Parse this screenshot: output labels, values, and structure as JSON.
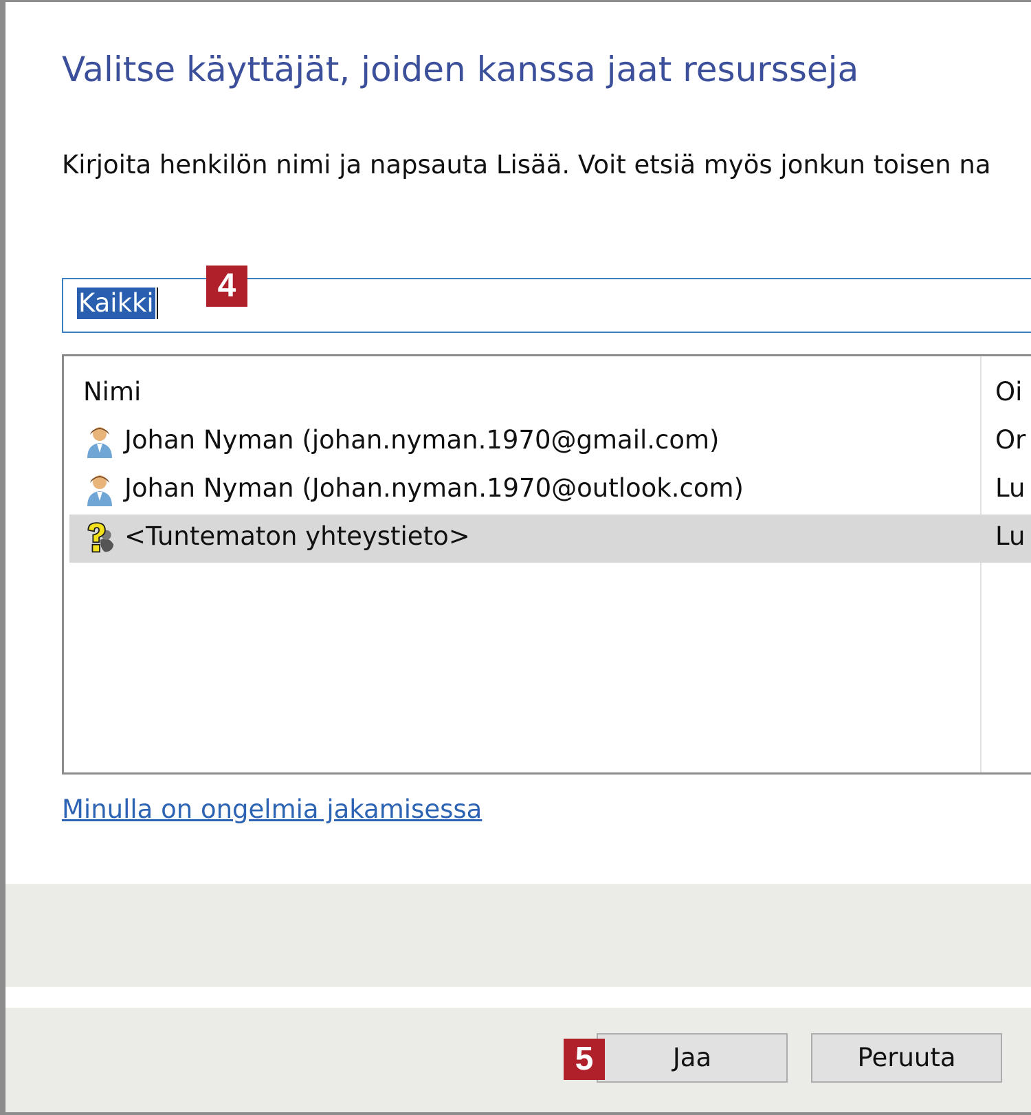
{
  "dialog": {
    "title": "Valitse käyttäjät, joiden kanssa jaat resursseja",
    "instructions": "Kirjoita henkilön nimi ja napsauta Lisää. Voit etsiä myös jonkun toisen na"
  },
  "search": {
    "value": "Kaikki"
  },
  "badges": {
    "step4": "4",
    "step5": "5"
  },
  "list": {
    "columns": {
      "name": "Nimi",
      "permission": "Oi"
    },
    "rows": [
      {
        "name": "Johan Nyman (johan.nyman.1970@gmail.com)",
        "permission": "Or",
        "icon": "user-icon"
      },
      {
        "name": "Johan Nyman (Johan.nyman.1970@outlook.com)",
        "permission": "Lu",
        "icon": "user-icon"
      },
      {
        "name": "<Tuntematon yhteystieto>",
        "permission": "Lu",
        "icon": "unknown-contact-icon",
        "selected": true
      }
    ]
  },
  "help_link": "Minulla on ongelmia jakamisessa",
  "buttons": {
    "share": "Jaa",
    "cancel": "Peruuta"
  },
  "colors": {
    "title": "#3b4f9a",
    "link": "#2d63b3",
    "badge": "#b0202a",
    "selection": "#2a5fb0"
  }
}
